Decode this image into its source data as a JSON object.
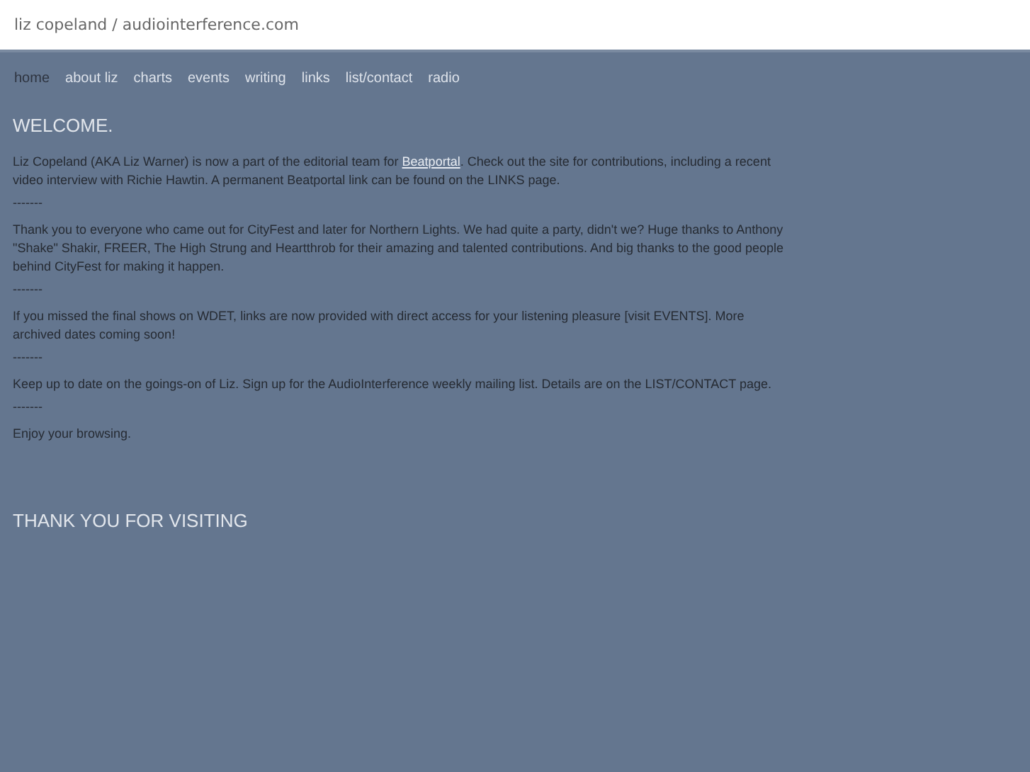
{
  "header": {
    "title": "liz copeland / audiointerference.com"
  },
  "nav": [
    {
      "label": "home",
      "selected": true
    },
    {
      "label": "about liz",
      "selected": false
    },
    {
      "label": "charts",
      "selected": false
    },
    {
      "label": "events",
      "selected": false
    },
    {
      "label": "writing",
      "selected": false
    },
    {
      "label": "links",
      "selected": false
    },
    {
      "label": "list/contact",
      "selected": false
    },
    {
      "label": "radio",
      "selected": false
    }
  ],
  "heading": "WELCOME.",
  "blocks": [
    {
      "kind": "para",
      "before": "Liz Copeland (AKA Liz Warner) is now a part of the editorial team for ",
      "link": "Beatportal",
      "after": ". Check out the site for contributions, including a recent video interview with Richie Hawtin. A permanent Beatportal link can be found on the LINKS page."
    },
    {
      "kind": "sep",
      "text": "-------"
    },
    {
      "kind": "para",
      "before": "Thank you to everyone who came out for CityFest and later for Northern Lights. We had quite a party, didn't we? Huge thanks to Anthony \"Shake\" Shakir, FREER, The High Strung and Heartthrob for their amazing and talented contributions. And big thanks to the good people behind CityFest for making it happen."
    },
    {
      "kind": "sep",
      "text": "-------"
    },
    {
      "kind": "para",
      "before": "If you missed the final shows on WDET, links are now provided with direct access for your listening pleasure [visit EVENTS]. More archived dates coming soon!"
    },
    {
      "kind": "sep",
      "text": "-------"
    },
    {
      "kind": "para",
      "before": "Keep up to date on the goings-on of Liz. Sign up for the AudioInterference weekly mailing list. Details are on the LIST/CONTACT page."
    },
    {
      "kind": "sep",
      "text": "-------"
    },
    {
      "kind": "para",
      "before": "Enjoy your browsing."
    }
  ],
  "footer_heading": "THANK YOU FOR VISITING"
}
